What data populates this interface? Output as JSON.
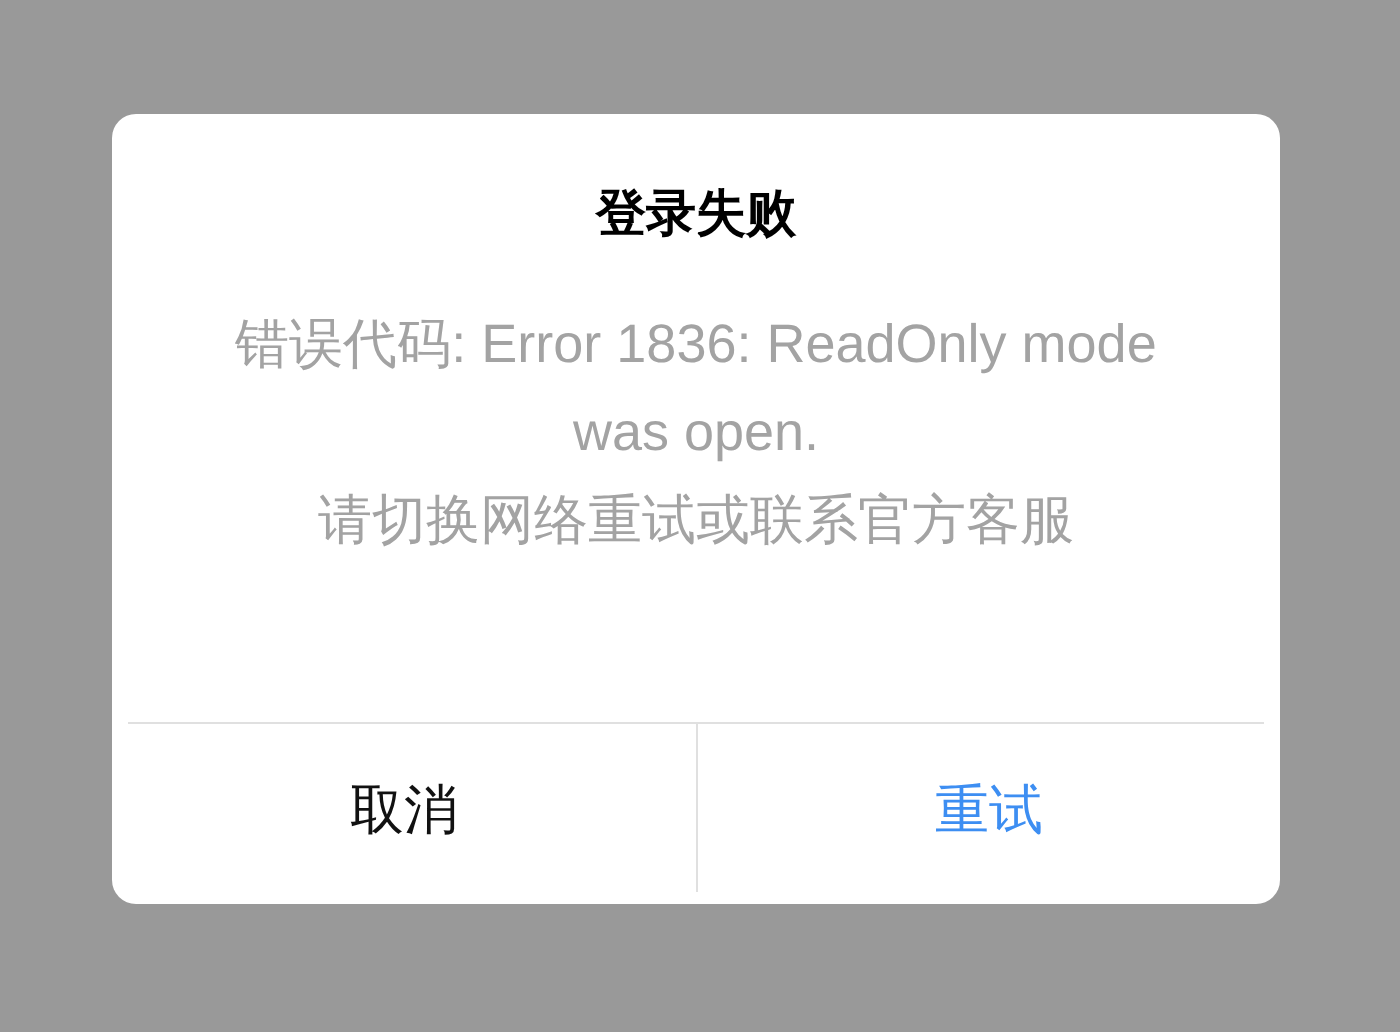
{
  "dialog": {
    "title": "登录失败",
    "message": [
      "错误代码: Error 1836: ReadOnly mode was open.",
      "请切换网络重试或联系官方客服"
    ],
    "buttons": [
      {
        "label": "取消",
        "kind": "cancel"
      },
      {
        "label": "重试",
        "kind": "primary"
      }
    ]
  }
}
